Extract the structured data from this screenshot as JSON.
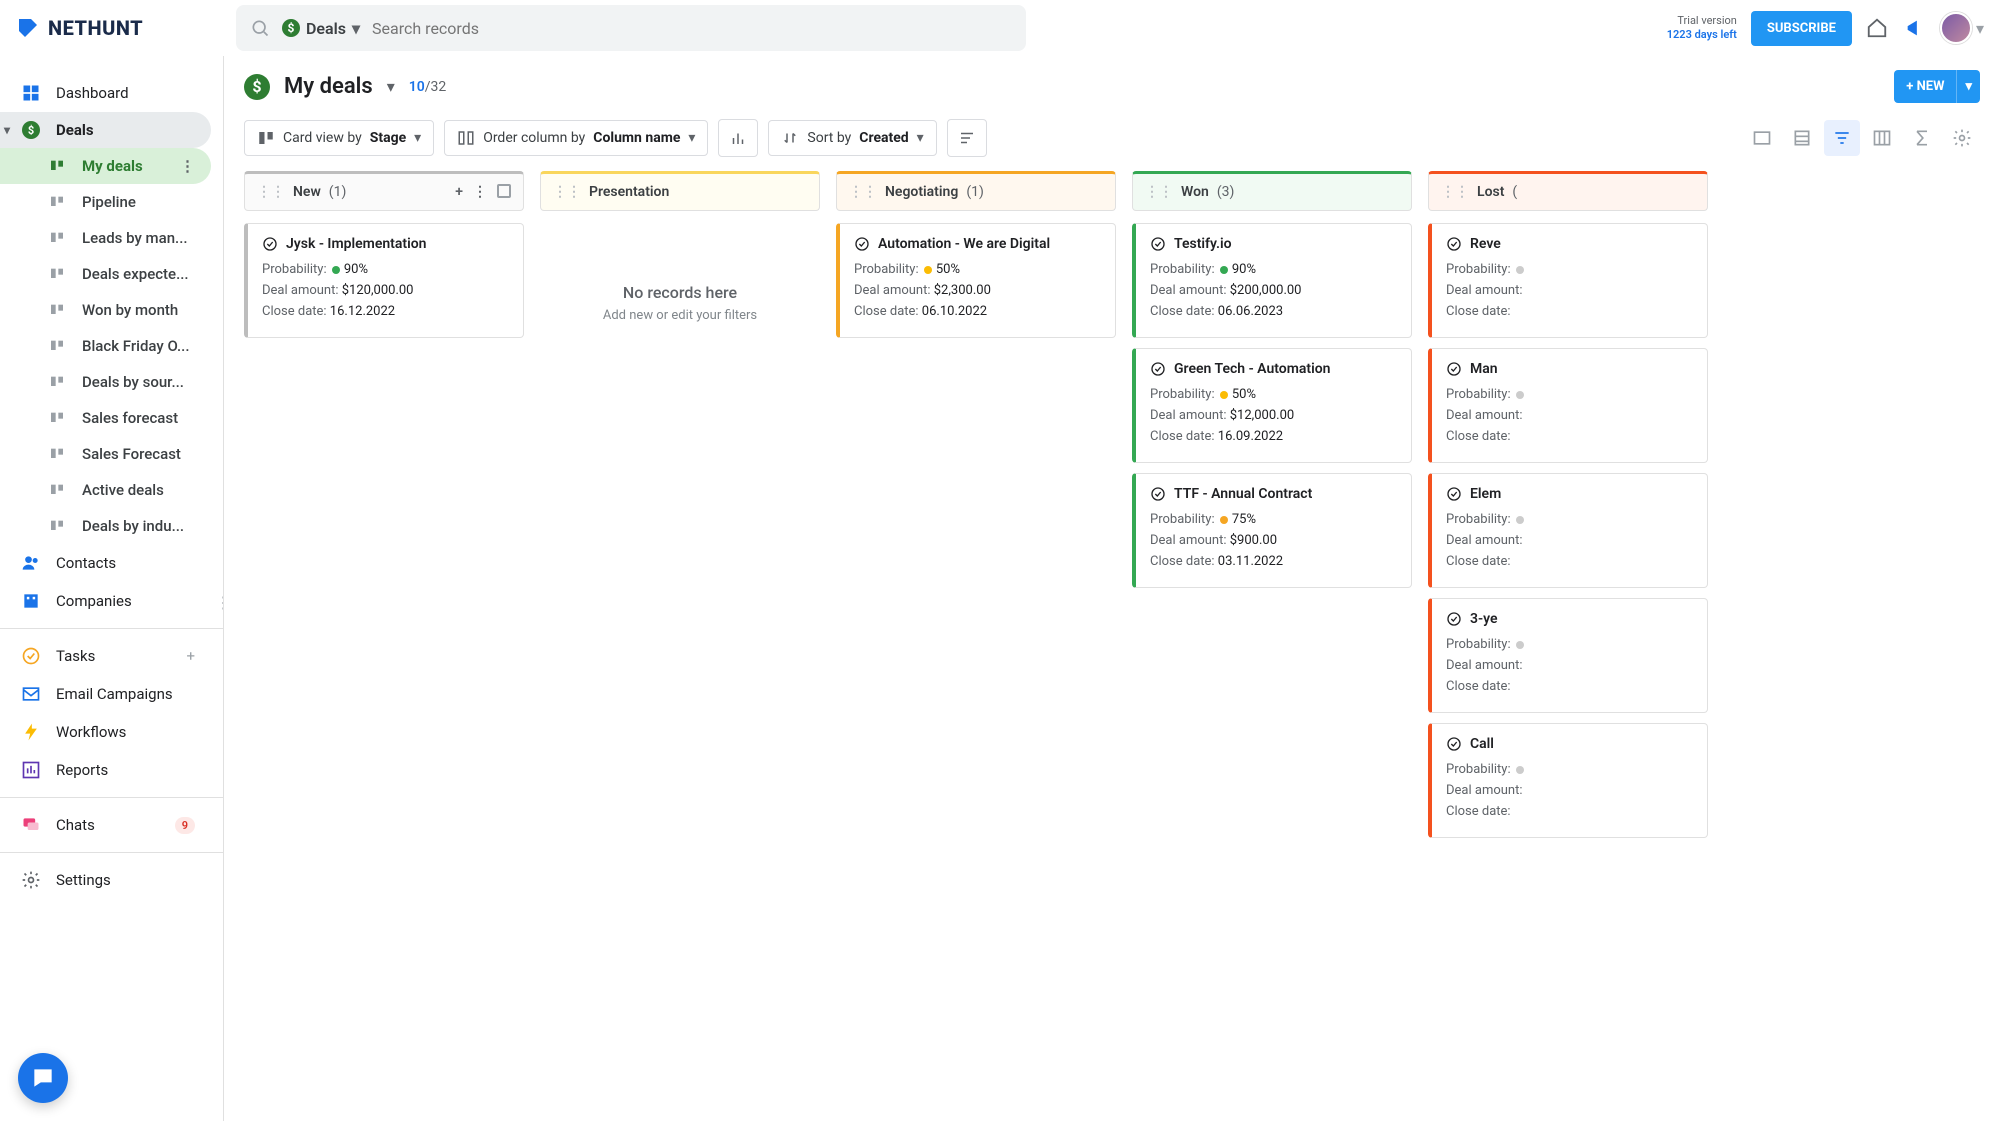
{
  "brand": "NETHUNT",
  "search": {
    "scope": "Deals",
    "placeholder": "Search records"
  },
  "trial": {
    "line1": "Trial version",
    "line2": "1223 days left"
  },
  "subscribe_label": "SUBSCRIBE",
  "sidebar": {
    "dashboard": "Dashboard",
    "deals": "Deals",
    "views": [
      "My deals",
      "Pipeline",
      "Leads by man...",
      "Deals expecte...",
      "Won by month",
      "Black Friday O...",
      "Deals by sour...",
      "Sales forecast",
      "Sales Forecast",
      "Active deals",
      "Deals by indu..."
    ],
    "contacts": "Contacts",
    "companies": "Companies",
    "tasks": "Tasks",
    "email_campaigns": "Email Campaigns",
    "workflows": "Workflows",
    "reports": "Reports",
    "chats": "Chats",
    "chats_badge": "9",
    "settings": "Settings"
  },
  "page": {
    "title": "My deals",
    "shown": "10",
    "total": "/32",
    "new_button": "+ NEW"
  },
  "toolbar": {
    "card_view_prefix": "Card view by ",
    "card_view_value": "Stage",
    "order_prefix": "Order column by ",
    "order_value": "Column name",
    "sort_prefix": "Sort by ",
    "sort_value": "Created"
  },
  "columns": [
    {
      "name": "New",
      "count": "(1)",
      "color": "#bdbdbd",
      "bg": "#fafafa",
      "left": "#bdbdbd",
      "show_controls": true,
      "cards": [
        {
          "title": "Jysk - Implementation",
          "prob": "90%",
          "prob_color": "#34a853",
          "amount": "$120,000.00",
          "close": "16.12.2022"
        }
      ]
    },
    {
      "name": "Presentation",
      "count": "",
      "color": "#f9d65c",
      "bg": "#fffdf2",
      "left": "#f9d65c",
      "empty": {
        "title": "No records here",
        "subtitle": "Add new or edit your filters"
      },
      "cards": []
    },
    {
      "name": "Negotiating",
      "count": "(1)",
      "color": "#f5a623",
      "bg": "#fff8ef",
      "left": "#f5a623",
      "cards": [
        {
          "title": "Automation - We are Digital",
          "prob": "50%",
          "prob_color": "#fbbc04",
          "amount": "$2,300.00",
          "close": "06.10.2022"
        }
      ]
    },
    {
      "name": "Won",
      "count": "(3)",
      "color": "#34a853",
      "bg": "#f1faf3",
      "left": "#34a853",
      "cards": [
        {
          "title": "Testify.io",
          "prob": "90%",
          "prob_color": "#34a853",
          "amount": "$200,000.00",
          "close": "06.06.2023"
        },
        {
          "title": "Green Tech - Automation",
          "prob": "50%",
          "prob_color": "#fbbc04",
          "amount": "$12,000.00",
          "close": "16.09.2022"
        },
        {
          "title": "TTF - Annual Contract",
          "prob": "75%",
          "prob_color": "#f5a623",
          "amount": "$900.00",
          "close": "03.11.2022"
        }
      ]
    },
    {
      "name": "Lost",
      "count": "(",
      "color": "#f4511e",
      "bg": "#fff4ef",
      "left": "#f4511e",
      "cards": [
        {
          "title": "Reve",
          "prob": "",
          "amount": "",
          "close": ""
        },
        {
          "title": "Man",
          "prob": "",
          "amount": "",
          "close": ""
        },
        {
          "title": "Elem",
          "prob": "",
          "amount": "",
          "close": ""
        },
        {
          "title": "3-ye",
          "prob": "",
          "amount": "",
          "close": ""
        },
        {
          "title": "Call",
          "prob": "",
          "amount": "",
          "close": ""
        }
      ]
    }
  ],
  "labels": {
    "probability": "Probability:",
    "deal_amount": "Deal amount:",
    "close_date": "Close date:"
  }
}
